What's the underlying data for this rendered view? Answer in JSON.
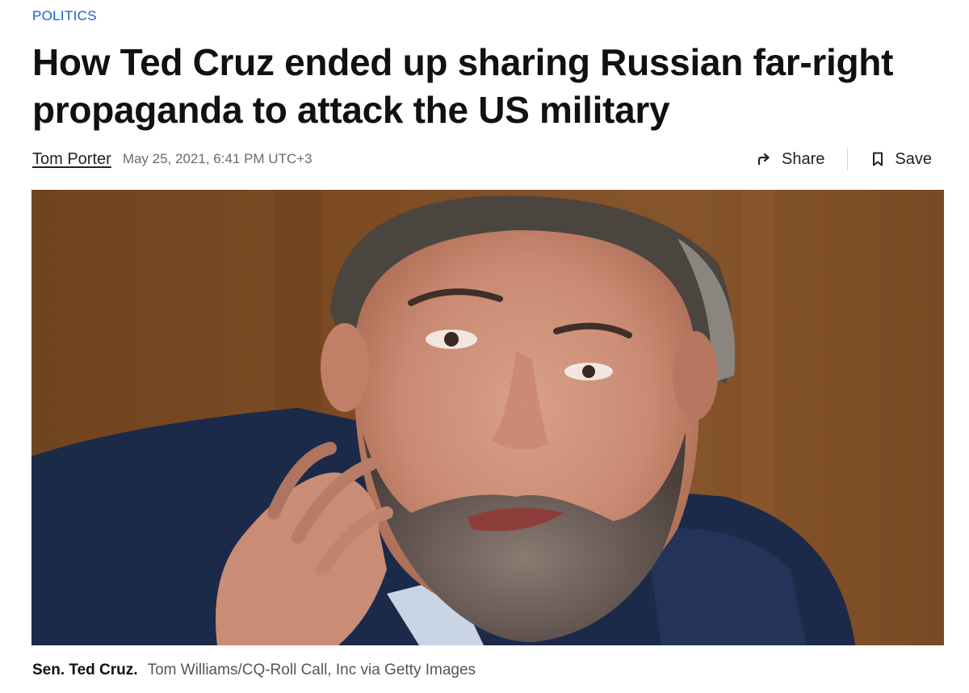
{
  "article": {
    "category": "POLITICS",
    "headline": "How Ted Cruz ended up sharing Russian far-right propaganda to attack the US military",
    "author": "Tom Porter",
    "date": "May 25, 2021, 6:41 PM UTC+3"
  },
  "actions": {
    "share_label": "Share",
    "save_label": "Save"
  },
  "photo": {
    "caption_name": "Sen. Ted Cruz.",
    "caption_credit": "Tom Williams/CQ-Roll Call, Inc via Getty Images"
  },
  "colors": {
    "category_link": "#1a5fd1",
    "headline": "#111111",
    "meta_gray": "#6b6b6b",
    "photo_background": "#7a4a23",
    "suit_navy": "#1c2a4a"
  },
  "icons": {
    "share": "share-arrow-icon",
    "save": "bookmark-icon"
  }
}
